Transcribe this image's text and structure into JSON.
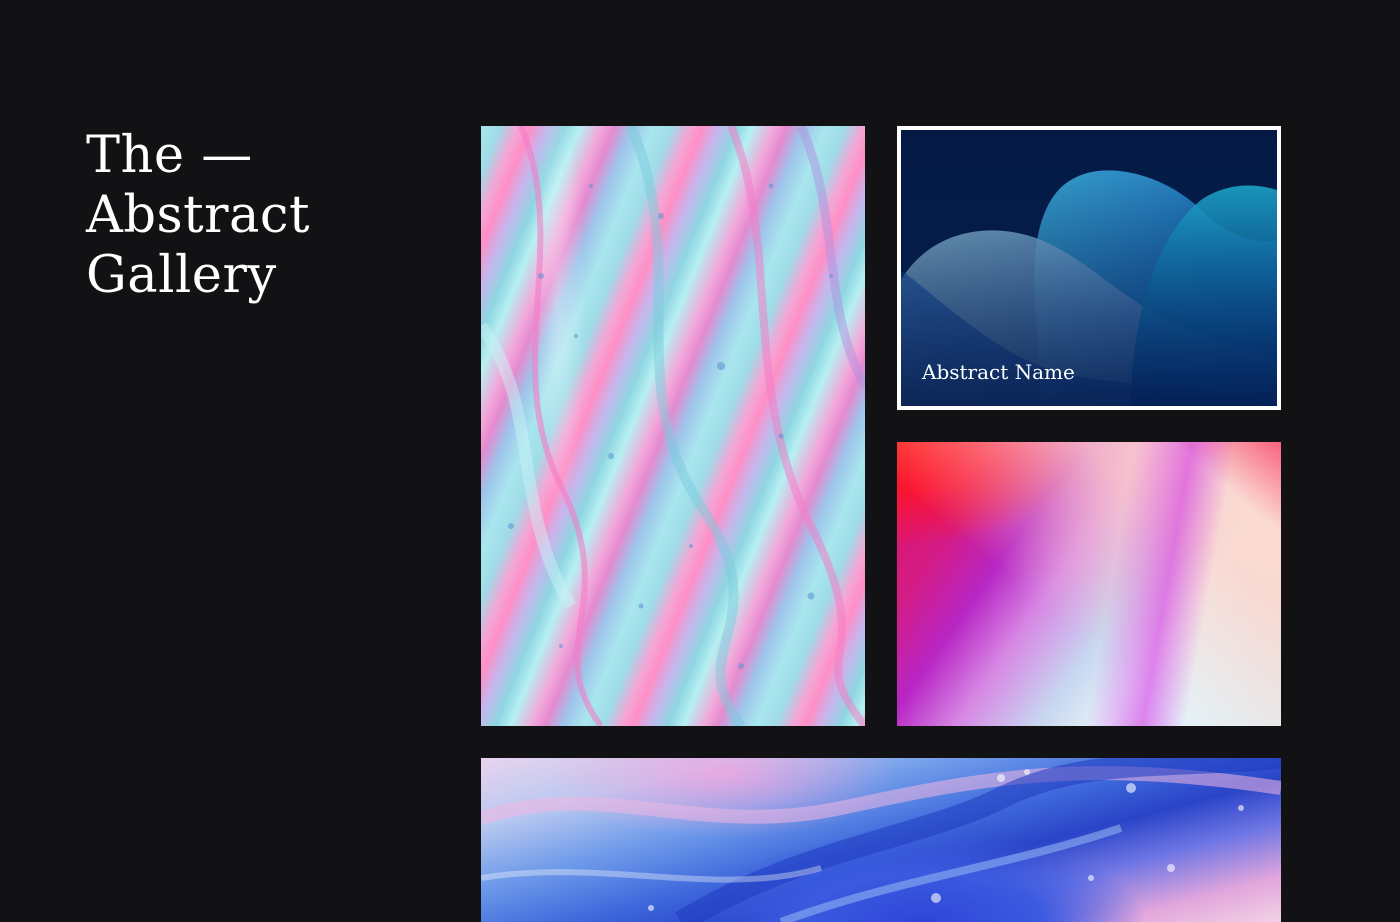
{
  "page": {
    "title_lines": [
      "The —",
      "Abstract",
      "Gallery"
    ]
  },
  "gallery": {
    "tiles": [
      {
        "icon": "marble-artwork-pink-teal",
        "caption": ""
      },
      {
        "icon": "blue-waves-artwork",
        "caption": "Abstract Name"
      },
      {
        "icon": "red-violet-gradient-artwork",
        "caption": ""
      },
      {
        "icon": "blue-pink-marble-artwork",
        "caption": ""
      }
    ]
  },
  "colors": {
    "background": "#121214",
    "text": "#ffffff",
    "featured_border": "#ffffff"
  }
}
